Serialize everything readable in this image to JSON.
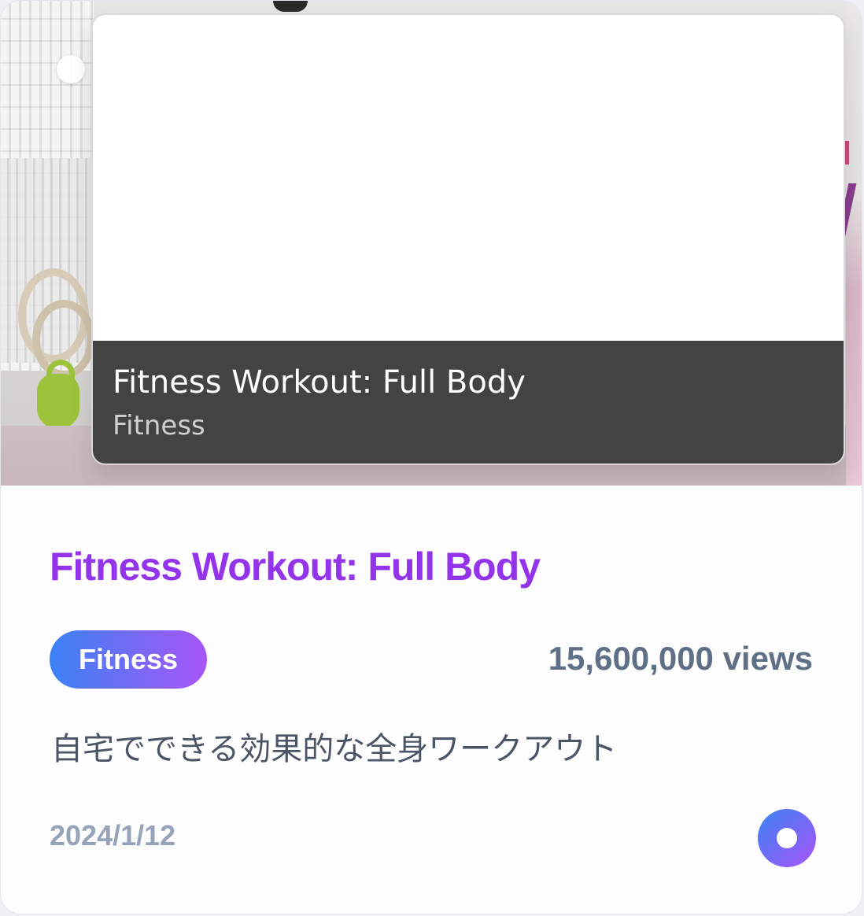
{
  "card": {
    "preview": {
      "title": "Fitness Workout: Full Body",
      "subtitle": "Fitness"
    },
    "title": "Fitness Workout: Full Body",
    "category_tag": "Fitness",
    "views": "15,600,000 views",
    "description": "自宅でできる効果的な全身ワークアウト",
    "date": "2024/1/12"
  },
  "colors": {
    "title": "#9333ea",
    "gradient_start": "#3b82f6",
    "gradient_end": "#a855f7",
    "views_text": "#5f6f86",
    "date_text": "#96a3b8",
    "preview_bar": "#434343"
  },
  "icons": {
    "top_left_dot": "circle-indicator-icon",
    "action_button": "record-dot-icon"
  }
}
